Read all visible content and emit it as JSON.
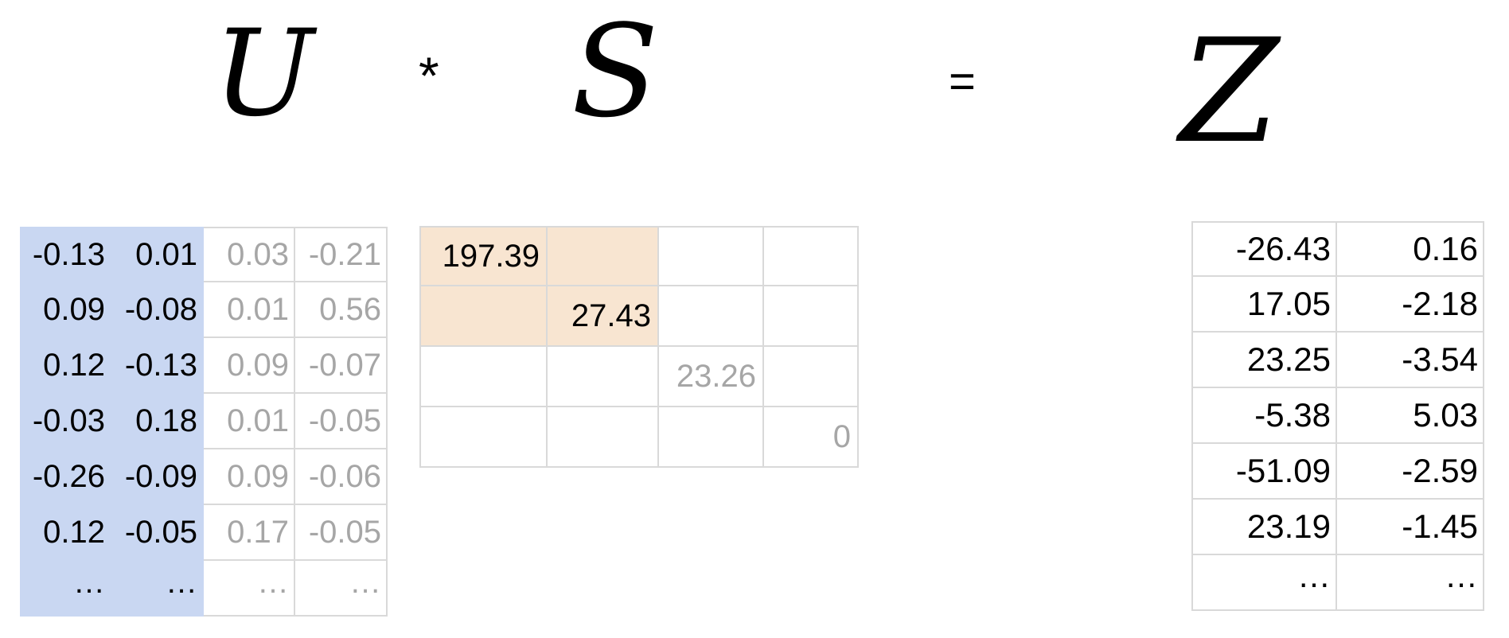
{
  "equation": {
    "u_symbol": "U",
    "times": "*",
    "s_symbol": "S",
    "equals": "=",
    "z_symbol": "Z"
  },
  "colors": {
    "u_highlight": "#c9d7f2",
    "s_highlight": "#f8e5d1",
    "muted_text": "#a6a6a6",
    "grid_line": "#d9d9d9"
  },
  "u_matrix": {
    "rows": [
      [
        "-0.13",
        "0.01",
        "0.03",
        "-0.21"
      ],
      [
        "0.09",
        "-0.08",
        "0.01",
        "0.56"
      ],
      [
        "0.12",
        "-0.13",
        "0.09",
        "-0.07"
      ],
      [
        "-0.03",
        "0.18",
        "0.01",
        "-0.05"
      ],
      [
        "-0.26",
        "-0.09",
        "0.09",
        "-0.06"
      ],
      [
        "0.12",
        "-0.05",
        "0.17",
        "-0.05"
      ],
      [
        "…",
        "…",
        "…",
        "…"
      ]
    ],
    "highlighted_columns": 2
  },
  "s_matrix": {
    "rows": [
      [
        "197.39",
        "",
        "",
        ""
      ],
      [
        "",
        "27.43",
        "",
        ""
      ],
      [
        "",
        "",
        "23.26",
        ""
      ],
      [
        "",
        "",
        "",
        "0"
      ]
    ],
    "highlighted_size": 2
  },
  "z_matrix": {
    "rows": [
      [
        "-26.43",
        "0.16"
      ],
      [
        "17.05",
        "-2.18"
      ],
      [
        "23.25",
        "-3.54"
      ],
      [
        "-5.38",
        "5.03"
      ],
      [
        "-51.09",
        "-2.59"
      ],
      [
        "23.19",
        "-1.45"
      ],
      [
        "…",
        "…"
      ]
    ]
  }
}
